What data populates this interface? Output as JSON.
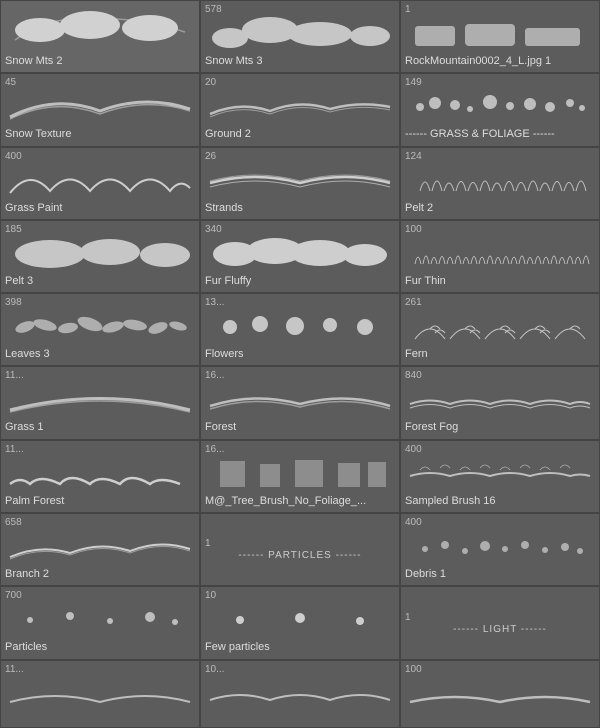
{
  "cells": [
    {
      "id": "snow-mts-2",
      "name": "Snow Mts 2",
      "number": "",
      "type": "brush",
      "brushStyle": "mountain-snow"
    },
    {
      "id": "snow-mts-3",
      "name": "Snow Mts 3",
      "number": "578",
      "type": "brush",
      "brushStyle": "mountain-snow2"
    },
    {
      "id": "rock-mountain",
      "name": "RockMountain0002_4_L.jpg 1",
      "number": "1",
      "type": "brush",
      "brushStyle": "rock"
    },
    {
      "id": "snow-texture",
      "name": "Snow Texture",
      "number": "45",
      "type": "brush",
      "brushStyle": "snow-texture"
    },
    {
      "id": "ground-2",
      "name": "Ground 2",
      "number": "20",
      "type": "brush",
      "brushStyle": "ground"
    },
    {
      "id": "grass-foliage",
      "name": "------ GRASS & FOLIAGE ------",
      "number": "149",
      "type": "separator",
      "brushStyle": "grass-cluster"
    },
    {
      "id": "grass-paint",
      "name": "Grass Paint",
      "number": "400",
      "type": "brush",
      "brushStyle": "grass-paint"
    },
    {
      "id": "strands",
      "name": "Strands",
      "number": "26",
      "type": "brush",
      "brushStyle": "strands"
    },
    {
      "id": "pelt-2",
      "name": "Pelt 2",
      "number": "124",
      "type": "brush",
      "brushStyle": "pelt"
    },
    {
      "id": "pelt-3",
      "name": "Pelt 3",
      "number": "185",
      "type": "brush",
      "brushStyle": "pelt3"
    },
    {
      "id": "fur-fluffy",
      "name": "Fur Fluffy",
      "number": "340",
      "type": "brush",
      "brushStyle": "fur-fluffy"
    },
    {
      "id": "fur-thin",
      "name": "Fur Thin",
      "number": "100",
      "type": "brush",
      "brushStyle": "fur-thin"
    },
    {
      "id": "leaves-3",
      "name": "Leaves 3",
      "number": "398",
      "type": "brush",
      "brushStyle": "leaves"
    },
    {
      "id": "flowers",
      "name": "Flowers",
      "number": "13...",
      "type": "brush",
      "brushStyle": "flowers"
    },
    {
      "id": "fern",
      "name": "Fern",
      "number": "261",
      "type": "brush",
      "brushStyle": "fern"
    },
    {
      "id": "grass-1",
      "name": "Grass 1",
      "number": "11...",
      "type": "brush",
      "brushStyle": "grass1"
    },
    {
      "id": "forest",
      "name": "Forest",
      "number": "16...",
      "type": "brush",
      "brushStyle": "forest"
    },
    {
      "id": "forest-fog",
      "name": "Forest Fog",
      "number": "840",
      "type": "brush",
      "brushStyle": "forest-fog"
    },
    {
      "id": "palm-forest",
      "name": "Palm Forest",
      "number": "11...",
      "type": "brush",
      "brushStyle": "palm"
    },
    {
      "id": "m-tree",
      "name": "M@_Tree_Brush_No_Foliage_...",
      "number": "16...",
      "type": "brush",
      "brushStyle": "tree-brush"
    },
    {
      "id": "sampled-brush",
      "name": "Sampled Brush 16",
      "number": "400",
      "type": "brush",
      "brushStyle": "sampled"
    },
    {
      "id": "branch-2",
      "name": "Branch 2",
      "number": "658",
      "type": "brush",
      "brushStyle": "branch"
    },
    {
      "id": "particles-sep",
      "name": "------ PARTICLES ------",
      "number": "1",
      "type": "separator-cell",
      "brushStyle": "none"
    },
    {
      "id": "debris-1",
      "name": "Debris 1",
      "number": "400",
      "type": "brush",
      "brushStyle": "debris"
    },
    {
      "id": "particles",
      "name": "Particles",
      "number": "700",
      "type": "brush",
      "brushStyle": "particles"
    },
    {
      "id": "few-particles",
      "name": "Few particles",
      "number": "10",
      "type": "brush",
      "brushStyle": "few-particles"
    },
    {
      "id": "light-sep",
      "name": "------ LIGHT ------",
      "number": "1",
      "type": "separator-cell",
      "brushStyle": "none"
    },
    {
      "id": "row-end-1",
      "name": "",
      "number": "11...",
      "type": "brush",
      "brushStyle": "wavy"
    },
    {
      "id": "row-end-2",
      "name": "",
      "number": "10...",
      "type": "brush",
      "brushStyle": "wavy2"
    },
    {
      "id": "row-end-3",
      "name": "",
      "number": "100",
      "type": "brush",
      "brushStyle": "wavy3"
    }
  ]
}
